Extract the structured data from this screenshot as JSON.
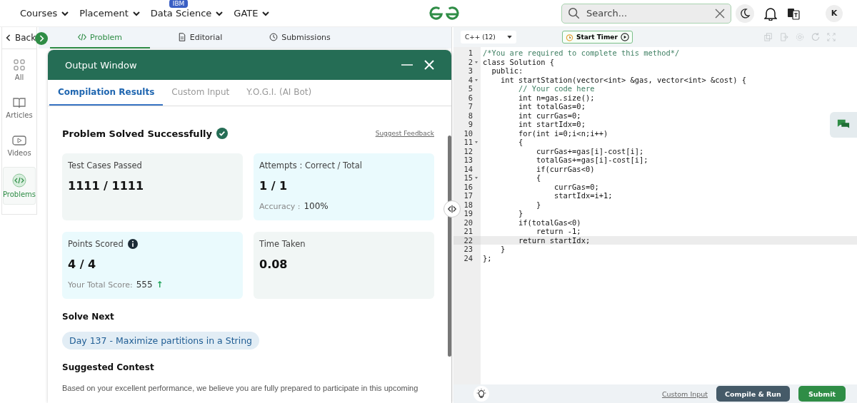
{
  "nav": {
    "menus": [
      {
        "label": "Courses"
      },
      {
        "label": "Placement"
      },
      {
        "label": "Data Science",
        "badge": "IBM"
      },
      {
        "label": "GATE"
      }
    ],
    "search": {
      "placeholder": "Search..."
    },
    "avatar": "K"
  },
  "sidebar": {
    "back": "Back",
    "items": [
      {
        "label": "All",
        "selected": false
      },
      {
        "label": "Articles",
        "selected": false
      },
      {
        "label": "Videos",
        "selected": false
      },
      {
        "label": "Problems",
        "selected": true
      }
    ]
  },
  "problem_tabs": [
    {
      "label": "Problem",
      "selected": true
    },
    {
      "label": "Editorial",
      "selected": false
    },
    {
      "label": "Submissions",
      "selected": false
    }
  ],
  "output_window": {
    "title": "Output Window",
    "tabs": [
      {
        "label": "Compilation Results",
        "selected": true
      },
      {
        "label": "Custom Input",
        "selected": false
      },
      {
        "label": "Y.O.G.I. (AI Bot)",
        "selected": false
      }
    ],
    "status": "Problem Solved Successfully",
    "feedback": "Suggest Feedback",
    "cards": [
      {
        "title": "Test Cases Passed",
        "value": "1111 / 1111",
        "color": "#f1f6f5"
      },
      {
        "title": "Attempts : Correct / Total",
        "value": "1 / 1",
        "extra_label": "Accuracy :",
        "extra_value": "100%",
        "color": "#eafafd"
      },
      {
        "title": "Points Scored",
        "info": true,
        "value": "4 / 4",
        "extra_label": "Your Total Score:",
        "extra_value": "555",
        "trend": "↑",
        "color": "#eafafd"
      },
      {
        "title": "Time Taken",
        "value": "0.08",
        "color": "#f1f6f5"
      }
    ],
    "solve_next": "Solve Next",
    "next_problem": "Day 137 - Maximize partitions in a String",
    "contest_heading": "Suggested Contest",
    "contest_text": "Based on your excellent performance, we believe you are fully prepared to participate in this upcoming"
  },
  "editor": {
    "language": "C++ (12)",
    "timer": "Start Timer",
    "lines": [
      {
        "number": "1",
        "text": "/*You are required to complete this method*/",
        "kind": "comment",
        "fold": false,
        "active": false
      },
      {
        "number": "2",
        "text": "class Solution {",
        "kind": "code",
        "fold": true,
        "active": false
      },
      {
        "number": "3",
        "text": "  public:",
        "kind": "code",
        "fold": false,
        "active": false
      },
      {
        "number": "4",
        "text": "    int startStation(vector<int> &gas, vector<int> &cost) {",
        "kind": "code",
        "fold": true,
        "active": false
      },
      {
        "number": "5",
        "text": "        // Your code here",
        "kind": "comment",
        "fold": false,
        "active": false
      },
      {
        "number": "6",
        "text": "        int n=gas.size();",
        "kind": "code",
        "fold": false,
        "active": false
      },
      {
        "number": "7",
        "text": "        int totalGas=0;",
        "kind": "code",
        "fold": false,
        "active": false
      },
      {
        "number": "8",
        "text": "        int currGas=0;",
        "kind": "code",
        "fold": false,
        "active": false
      },
      {
        "number": "9",
        "text": "        int startIdx=0;",
        "kind": "code",
        "fold": false,
        "active": false
      },
      {
        "number": "10",
        "text": "        for(int i=0;i<n;i++)",
        "kind": "code",
        "fold": false,
        "active": false
      },
      {
        "number": "11",
        "text": "        {",
        "kind": "code",
        "fold": true,
        "active": false
      },
      {
        "number": "12",
        "text": "            currGas+=gas[i]-cost[i];",
        "kind": "code",
        "fold": false,
        "active": false
      },
      {
        "number": "13",
        "text": "            totalGas+=gas[i]-cost[i];",
        "kind": "code",
        "fold": false,
        "active": false
      },
      {
        "number": "14",
        "text": "            if(currGas<0)",
        "kind": "code",
        "fold": false,
        "active": false
      },
      {
        "number": "15",
        "text": "            {",
        "kind": "code",
        "fold": true,
        "active": false
      },
      {
        "number": "16",
        "text": "                currGas=0;",
        "kind": "code",
        "fold": false,
        "active": false
      },
      {
        "number": "17",
        "text": "                startIdx=i+1;",
        "kind": "code",
        "fold": false,
        "active": false
      },
      {
        "number": "18",
        "text": "            }",
        "kind": "code",
        "fold": false,
        "active": false
      },
      {
        "number": "19",
        "text": "        }",
        "kind": "code",
        "fold": false,
        "active": false
      },
      {
        "number": "20",
        "text": "        if(totalGas<0)",
        "kind": "code",
        "fold": false,
        "active": false
      },
      {
        "number": "21",
        "text": "            return -1;",
        "kind": "code",
        "fold": false,
        "active": false
      },
      {
        "number": "22",
        "text": "        return startIdx;",
        "kind": "code",
        "fold": false,
        "active": true
      },
      {
        "number": "23",
        "text": "    }",
        "kind": "code",
        "fold": false,
        "active": false
      },
      {
        "number": "24",
        "text": "};",
        "kind": "code",
        "fold": false,
        "active": false
      }
    ],
    "custom_input": "Custom Input",
    "compile": "Compile & Run",
    "submit": "Submit"
  }
}
